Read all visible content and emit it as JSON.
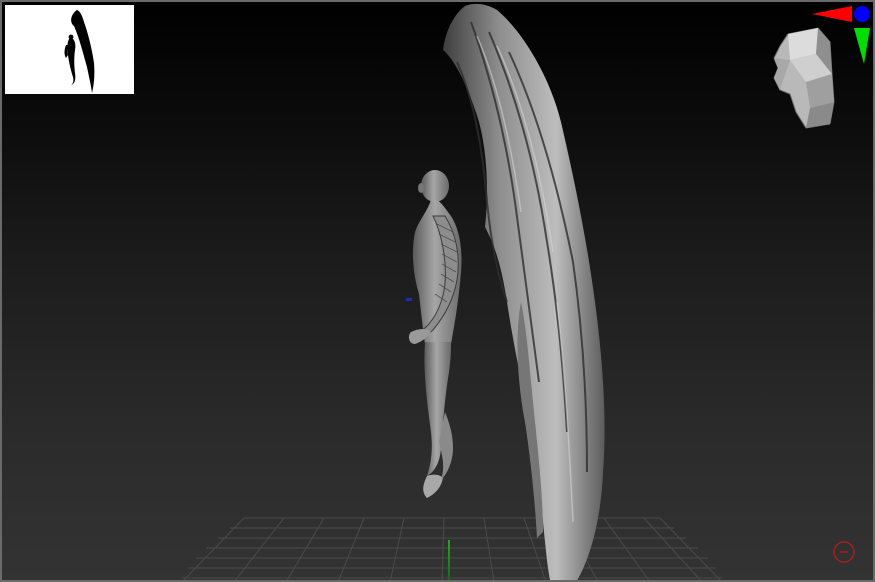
{
  "app": {
    "canvas": "3d-sculpt-viewport"
  },
  "navigator": {
    "icon": "model-silhouette-thumbnail"
  },
  "gizmos": {
    "orientation_head": "head-orientation-icon",
    "axis_colors": {
      "x": "#ff0000",
      "y": "#00e000",
      "z": "#0000ff"
    },
    "pivot": "pivot-circle-icon"
  },
  "scene": {
    "object": "winged-figure-sculpt",
    "floor_grid": "on"
  },
  "colors": {
    "viewport_top": "#000000",
    "viewport_bottom": "#333333",
    "border": "#6a6a6a",
    "clay": "#9a9a9a",
    "pivot": "#c21a1a"
  }
}
